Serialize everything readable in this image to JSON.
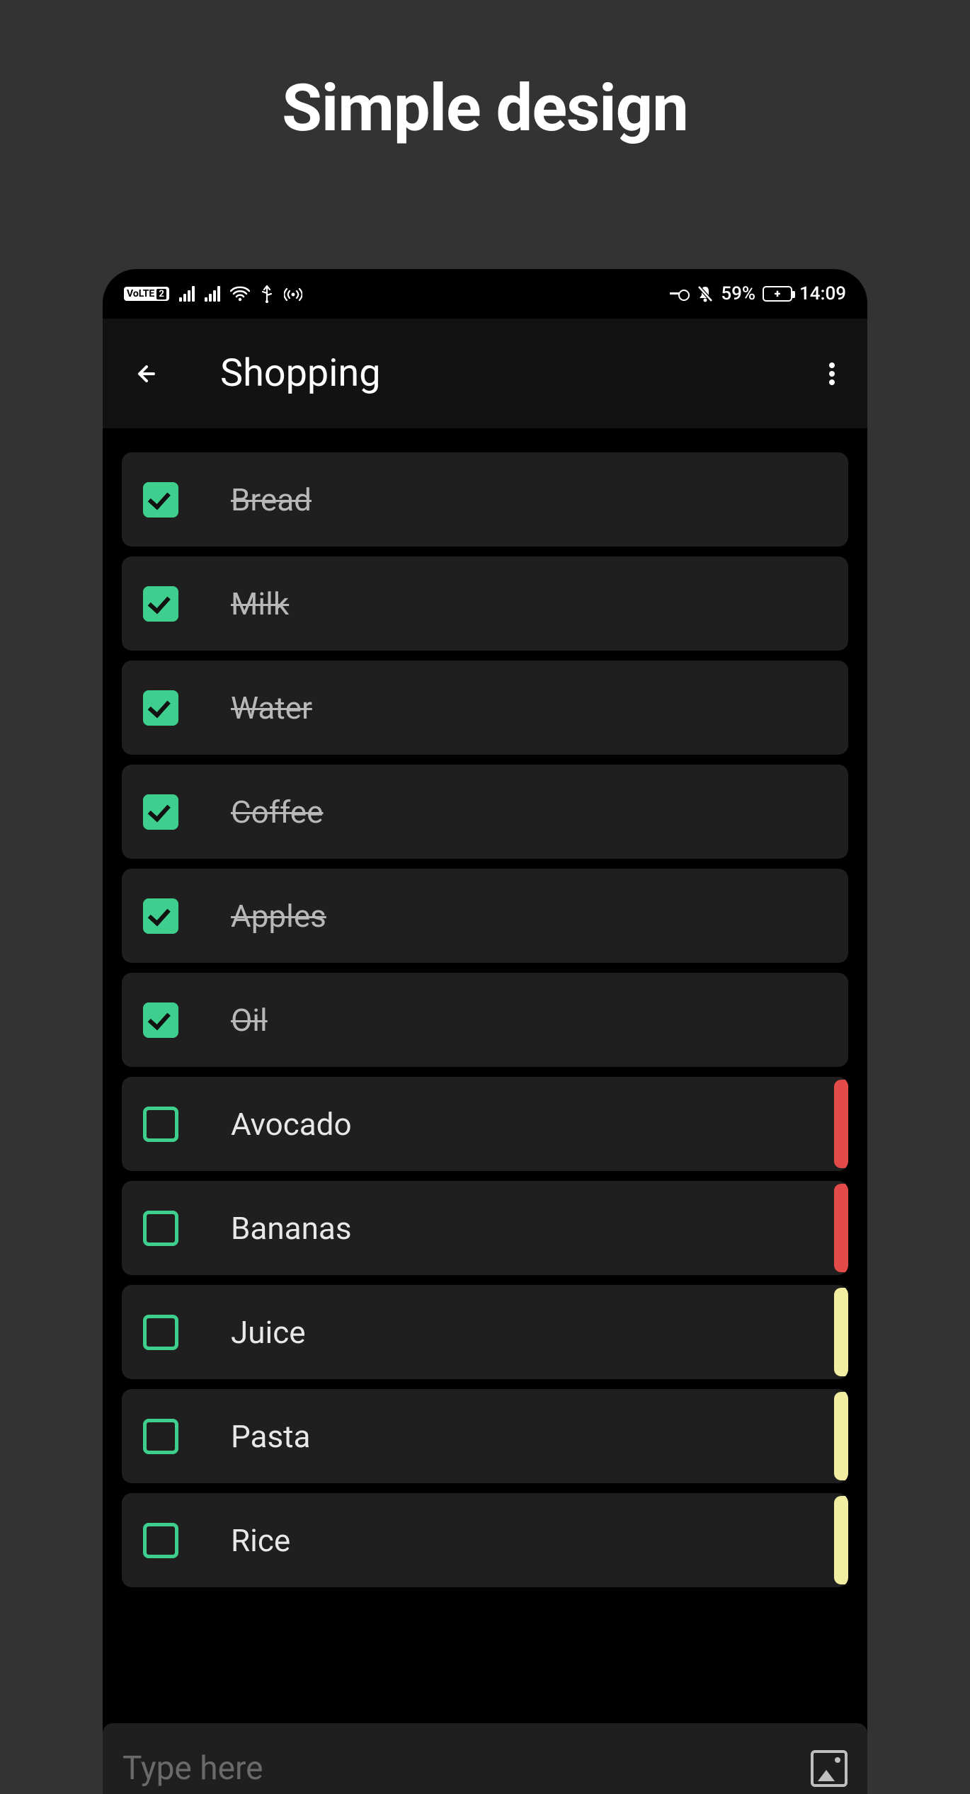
{
  "headline": "Simple design",
  "status_bar": {
    "volte_label": "VoLTE",
    "volte_sim": "2",
    "battery_percent": "59%",
    "time": "14:09"
  },
  "app_bar": {
    "title": "Shopping"
  },
  "list": {
    "items": [
      {
        "label": "Bread",
        "checked": true,
        "accent": null
      },
      {
        "label": "Milk",
        "checked": true,
        "accent": null
      },
      {
        "label": "Water",
        "checked": true,
        "accent": null
      },
      {
        "label": "Coffee",
        "checked": true,
        "accent": null
      },
      {
        "label": "Apples",
        "checked": true,
        "accent": null
      },
      {
        "label": "Oil",
        "checked": true,
        "accent": null
      },
      {
        "label": "Avocado",
        "checked": false,
        "accent": "red"
      },
      {
        "label": "Bananas",
        "checked": false,
        "accent": "red"
      },
      {
        "label": "Juice",
        "checked": false,
        "accent": "yellow"
      },
      {
        "label": "Pasta",
        "checked": false,
        "accent": "yellow"
      },
      {
        "label": "Rice",
        "checked": false,
        "accent": "yellow"
      }
    ]
  },
  "composer": {
    "placeholder": "Type here"
  },
  "colors": {
    "accent_green": "#3ecf8e",
    "accent_red": "#e24b47",
    "accent_yellow": "#f1eea2"
  }
}
